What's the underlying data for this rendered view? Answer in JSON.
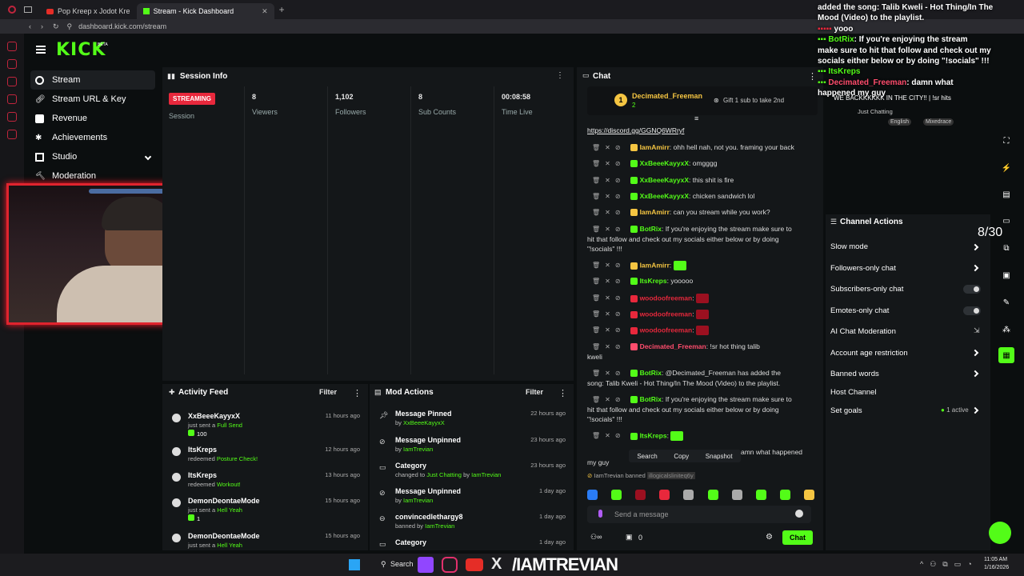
{
  "browser": {
    "tabs": [
      {
        "label": "Pop Kreep x Jodot Kre"
      },
      {
        "label": "Stream - Kick Dashboard"
      }
    ],
    "url": "dashboard.kick.com/stream"
  },
  "brand": {
    "logo": "KICK",
    "beta": "BETA"
  },
  "sidebar": {
    "items": [
      {
        "label": "Stream"
      },
      {
        "label": "Stream URL & Key"
      },
      {
        "label": "Revenue"
      },
      {
        "label": "Achievements"
      },
      {
        "label": "Studio"
      },
      {
        "label": "Moderation"
      }
    ]
  },
  "session": {
    "title": "Session Info",
    "status": "STREAMING",
    "session_label": "Session",
    "stats": [
      {
        "value": "8",
        "label": "Viewers"
      },
      {
        "value": "1,102",
        "label": "Followers"
      },
      {
        "value": "8",
        "label": "Sub Counts"
      },
      {
        "value": "00:08:58",
        "label": "Time Live"
      }
    ]
  },
  "activity": {
    "title": "Activity Feed",
    "filter": "Filter",
    "items": [
      {
        "user": "XxBeeeKayyxX",
        "line1": "just sent a ",
        "hl": "Full Send",
        "extra": "100",
        "time": "11 hours ago"
      },
      {
        "user": "ItsKreps",
        "line1": "redeemed ",
        "hl": "Posture Check!",
        "extra": "",
        "time": "12 hours ago"
      },
      {
        "user": "ItsKreps",
        "line1": "redeemed ",
        "hl": "Workout!",
        "extra": "",
        "time": "13 hours ago"
      },
      {
        "user": "DemonDeontaeMode",
        "line1": "just sent a ",
        "hl": "Hell Yeah",
        "extra": "1",
        "time": "15 hours ago"
      },
      {
        "user": "DemonDeontaeMode",
        "line1": "just sent a ",
        "hl": "Hell Yeah",
        "extra": "",
        "time": "15 hours ago"
      }
    ]
  },
  "modactions": {
    "title": "Mod Actions",
    "filter": "Filter",
    "items": [
      {
        "action": "Message Pinned",
        "pre": "by ",
        "hl": "XxBeeeKayyxX",
        "post": "",
        "hl2": "",
        "time": "22 hours ago"
      },
      {
        "action": "Message Unpinned",
        "pre": "by ",
        "hl": "IamTrevian",
        "post": "",
        "hl2": "",
        "time": "23 hours ago"
      },
      {
        "action": "Category",
        "pre": "changed to ",
        "hl": "Just Chatting",
        "post": " by ",
        "hl2": "IamTrevian",
        "time": "23 hours ago"
      },
      {
        "action": "Message Unpinned",
        "pre": "by ",
        "hl": "IamTrevian",
        "post": "",
        "hl2": "",
        "time": "1 day ago"
      },
      {
        "action": "convincedlethargy8",
        "pre": "banned by ",
        "hl": "IamTrevian",
        "post": "",
        "hl2": "",
        "time": "1 day ago"
      },
      {
        "action": "Category",
        "pre": "",
        "hl": "",
        "post": "",
        "hl2": "",
        "time": "1 day ago"
      }
    ]
  },
  "chat": {
    "title": "Chat",
    "pinned_user": "Decimated_Freeman",
    "pinned_count": "2",
    "gift_label": "Gift 1 sub to take 2nd",
    "link": "https://discord.gg/GGNQ6WRryf",
    "messages": [
      {
        "user": "IamAmirr",
        "color": "#f5c542",
        "text": "ohh hell nah, not you. framing your back"
      },
      {
        "user": "XxBeeeKayyxX",
        "color": "#53fc18",
        "text": "omgggg"
      },
      {
        "user": "XxBeeeKayyxX",
        "color": "#53fc18",
        "text": "this shit is fire"
      },
      {
        "user": "XxBeeeKayyxX",
        "color": "#53fc18",
        "text": "chicken sandwich lol"
      },
      {
        "user": "IamAmirr",
        "color": "#f5c542",
        "text": "can you stream while you work?"
      },
      {
        "user": "BotRix",
        "color": "#53fc18",
        "text": "If you're enjoying the stream make sure to",
        "text2": "hit that follow and check out my socials either below or by doing",
        "text3": "\"!socials\" !!!"
      },
      {
        "user": "IamAmirr",
        "color": "#f5c542",
        "text": ""
      },
      {
        "user": "ItsKreps",
        "color": "#53fc18",
        "text": "yooooo"
      },
      {
        "user": "woodoofreeman",
        "color": "#e8283c",
        "text": ""
      },
      {
        "user": "woodoofreeman",
        "color": "#e8283c",
        "text": ""
      },
      {
        "user": "woodoofreeman",
        "color": "#e8283c",
        "text": ""
      },
      {
        "user": "Decimated_Freeman",
        "color": "#ff4d6d",
        "text": "!sr hot thing talib",
        "text2": "kweli"
      },
      {
        "user": "BotRix",
        "color": "#53fc18",
        "text": "@Decimated_Freeman has added the",
        "text2": "song: Talib Kweli - Hot Thing/In The Mood (Video) to the playlist."
      },
      {
        "user": "BotRix",
        "color": "#53fc18",
        "text": "If you're enjoying the stream make sure to",
        "text2": "hit that follow and check out my socials either below or by doing",
        "text3": "\"!socials\" !!!"
      },
      {
        "user": "ItsKreps",
        "color": "#53fc18",
        "text": ""
      }
    ],
    "last_partial": "amn what happened",
    "last_partial2": "my guy",
    "context_menu": [
      "Search",
      "Copy",
      "Snapshot"
    ],
    "ban_notice": "IamTrevian banned",
    "ban_target": "illogicalsliniteq6y",
    "placeholder": "Send a message",
    "count_zero": "0",
    "send_label": "Chat"
  },
  "overlay": {
    "line1": "added the song: Talib Kweli - Hot Thing/In The",
    "line2": "Mood (Video) to the playlist.",
    "line3": "yooo",
    "line4": "BotRix",
    "line4b": ": If you're enjoying the stream",
    "line5": "make sure to hit that follow and check out my",
    "line6": "socials either below or by doing \"!socials\" !!!",
    "line7": "ItsKreps",
    "line8a": "Decimated_Freeman",
    "line8b": ": damn what",
    "line9": "happened my guy",
    "marquee": "WE BACKKKKKK IN THE CITY!! | !sr hits",
    "tag1": "Just Chatting",
    "tag2": "English",
    "tag3": "Mixedrace",
    "counter": "8/30"
  },
  "channel_actions": {
    "title": "Channel Actions",
    "rows": [
      {
        "label": "Slow mode"
      },
      {
        "label": "Followers-only chat"
      },
      {
        "label": "Subscribers-only chat"
      },
      {
        "label": "Emotes-only chat"
      },
      {
        "label": "AI Chat Moderation"
      },
      {
        "label": "Account age restriction"
      },
      {
        "label": "Banned words"
      },
      {
        "label": "Host Channel"
      },
      {
        "label": "Set goals"
      }
    ],
    "goals_status": "1 active"
  },
  "taskbar": {
    "search": "Search",
    "watermark": "/IAMTREVIAN",
    "time": "11:05 AM",
    "date": "1/16/2026"
  }
}
